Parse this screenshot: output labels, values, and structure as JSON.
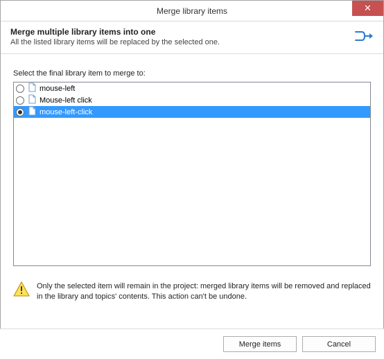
{
  "window": {
    "title": "Merge library items",
    "close_glyph": "✕"
  },
  "header": {
    "heading": "Merge multiple library items into one",
    "subheading": "All the listed library items will be replaced by the selected one."
  },
  "instruction": "Select the final library item to merge to:",
  "items": [
    {
      "label": "mouse-left",
      "selected": false
    },
    {
      "label": "Mouse-left click",
      "selected": false
    },
    {
      "label": "mouse-left-click",
      "selected": true
    }
  ],
  "warning": "Only the selected item will remain in the project: merged library items will be removed and replaced in the library and topics' contents. This action can't be undone.",
  "buttons": {
    "merge": "Merge items",
    "cancel": "Cancel"
  }
}
